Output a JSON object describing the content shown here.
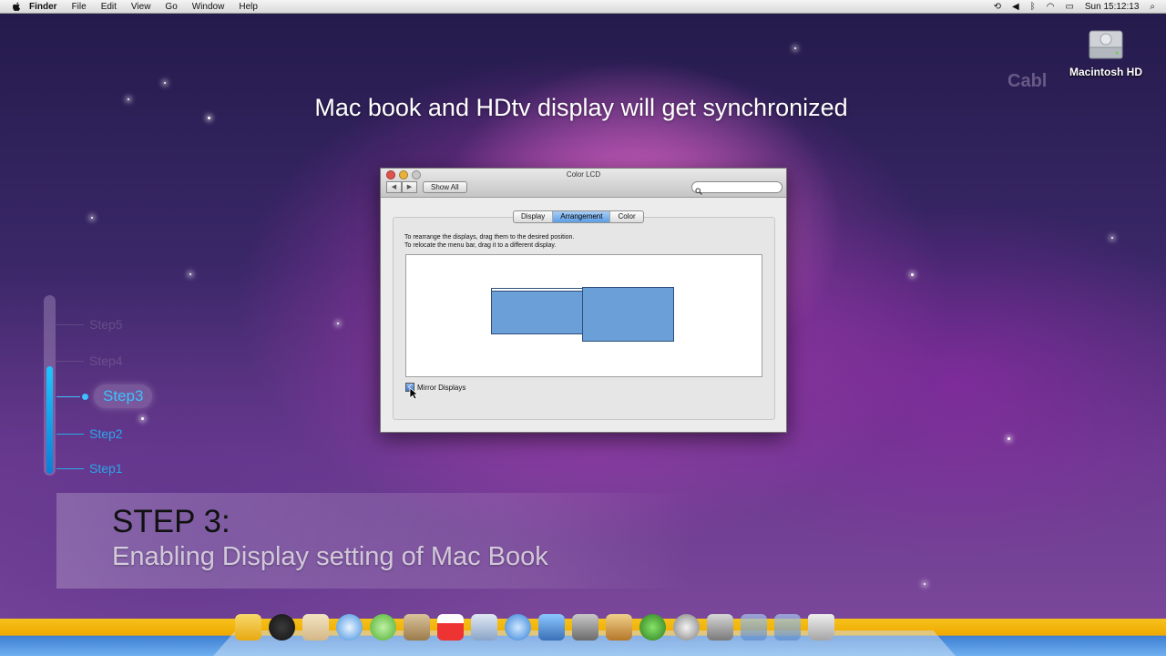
{
  "menubar": {
    "app": "Finder",
    "items": [
      "File",
      "Edit",
      "View",
      "Go",
      "Window",
      "Help"
    ],
    "clock": "Sun 15:12:13"
  },
  "desktop": {
    "headline": "Mac book and HDtv display will get synchronized",
    "hd_label": "Macintosh HD",
    "watermark": "Cabl"
  },
  "window": {
    "title": "Color LCD",
    "show_all": "Show All",
    "tabs": [
      "Display",
      "Arrangement",
      "Color"
    ],
    "active_tab": "Arrangement",
    "instructions": [
      "To rearrange the displays, drag them to the desired position.",
      "To relocate the menu bar, drag it to a different display."
    ],
    "mirror_label": "Mirror Displays",
    "mirror_checked": true
  },
  "steps": {
    "items": [
      "Step5",
      "Step4",
      "Step3",
      "Step2",
      "Step1"
    ],
    "active": "Step3"
  },
  "caption": {
    "title": "STEP 3:",
    "subtitle": "Enabling Display setting of Mac Book"
  },
  "colors": {
    "accent": "#2aa7e8",
    "display_blue": "#6b9fd8",
    "dock_yellow": "#f0a900"
  },
  "dock": {
    "icons": [
      "finder-icon",
      "dashboard-icon",
      "mail-stamp-icon",
      "safari-icon",
      "ichat-icon",
      "address-book-icon",
      "ical-icon",
      "preview-icon",
      "itunes-icon",
      "iphoto-icon",
      "imovie-icon",
      "garageband-icon",
      "time-machine-icon",
      "time-machine-clock-icon",
      "system-preferences-icon",
      "applications-folder-icon",
      "documents-folder-icon",
      "trash-icon"
    ]
  }
}
